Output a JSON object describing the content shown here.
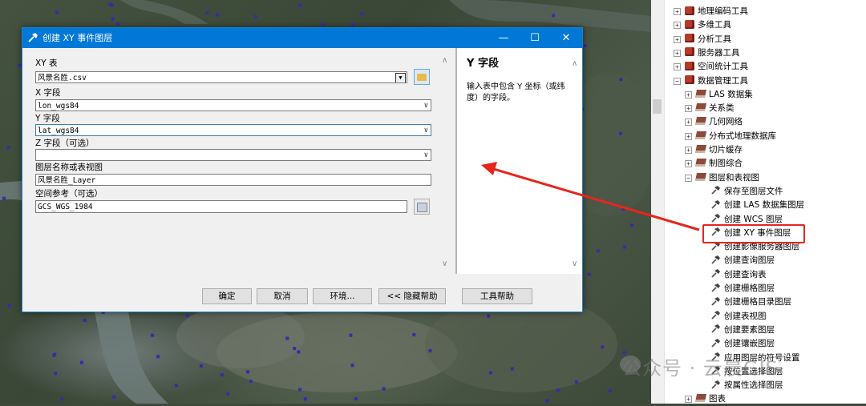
{
  "dialog": {
    "title": "创建 XY 事件图层",
    "fields": {
      "xy_table_label": "XY 表",
      "xy_table_value": "风景名胜.csv",
      "x_field_label": "X 字段",
      "x_field_value": "lon_wgs84",
      "y_field_label": "Y 字段",
      "y_field_value": "lat_wgs84",
      "z_field_label": "Z 字段（可选）",
      "z_field_value": "",
      "layer_name_label": "图层名称或表视图",
      "layer_name_value": "风景名胜_Layer",
      "spatial_ref_label": "空间参考（可选）",
      "spatial_ref_value": "GCS_WGS_1984"
    },
    "buttons": {
      "ok": "确定",
      "cancel": "取消",
      "environments": "环境...",
      "hide_help": "<< 隐藏帮助",
      "tool_help": "工具帮助"
    },
    "help": {
      "title": "Y 字段",
      "text": "输入表中包含 Y 坐标（或纬度）的字段。"
    },
    "window_controls": {
      "minimize": "—",
      "maximize": "☐",
      "close": "✕"
    }
  },
  "toolbox": {
    "items": [
      {
        "label": "地理编码工具",
        "icon": "toolbox-icon",
        "expander": "+"
      },
      {
        "label": "多维工具",
        "icon": "toolbox-icon",
        "expander": "+"
      },
      {
        "label": "分析工具",
        "icon": "toolbox-icon",
        "expander": "+"
      },
      {
        "label": "服务器工具",
        "icon": "toolbox-icon",
        "expander": "+"
      },
      {
        "label": "空间统计工具",
        "icon": "toolbox-icon",
        "expander": "+"
      },
      {
        "label": "数据管理工具",
        "icon": "toolbox-icon",
        "expander": "−"
      },
      {
        "label": "LAS 数据集",
        "icon": "toolset-icon",
        "expander": "+"
      },
      {
        "label": "关系类",
        "icon": "toolset-icon",
        "expander": "+"
      },
      {
        "label": "几何网络",
        "icon": "toolset-icon",
        "expander": "+"
      },
      {
        "label": "分布式地理数据库",
        "icon": "toolset-icon",
        "expander": "+"
      },
      {
        "label": "切片缓存",
        "icon": "toolset-icon",
        "expander": "+"
      },
      {
        "label": "制图综合",
        "icon": "toolset-icon",
        "expander": "+"
      },
      {
        "label": "图层和表视图",
        "icon": "toolset-icon",
        "expander": "−"
      },
      {
        "label": "保存至图层文件",
        "icon": "hammer-icon"
      },
      {
        "label": "创建 LAS 数据集图层",
        "icon": "hammer-icon"
      },
      {
        "label": "创建 WCS 图层",
        "icon": "hammer-icon"
      },
      {
        "label": "创建 XY 事件图层",
        "icon": "hammer-icon",
        "highlighted": true
      },
      {
        "label": "创建影像服务器图层",
        "icon": "hammer-icon"
      },
      {
        "label": "创建查询图层",
        "icon": "hammer-icon"
      },
      {
        "label": "创建查询表",
        "icon": "hammer-icon"
      },
      {
        "label": "创建栅格图层",
        "icon": "hammer-icon"
      },
      {
        "label": "创建栅格目录图层",
        "icon": "hammer-icon"
      },
      {
        "label": "创建表视图",
        "icon": "hammer-icon"
      },
      {
        "label": "创建要素图层",
        "icon": "hammer-icon"
      },
      {
        "label": "创建镶嵌图层",
        "icon": "hammer-icon"
      },
      {
        "label": "应用图层的符号设置",
        "icon": "hammer-icon"
      },
      {
        "label": "按位置选择图层",
        "icon": "hammer-icon"
      },
      {
        "label": "按属性选择图层",
        "icon": "hammer-icon"
      },
      {
        "label": "图表",
        "icon": "toolset-icon",
        "expander": "+"
      }
    ]
  },
  "watermark": "公众号 · 云晨GIS",
  "colors": {
    "titlebar": "#0078d7",
    "highlight_box": "#e5261e",
    "arrow": "#e5261e"
  }
}
